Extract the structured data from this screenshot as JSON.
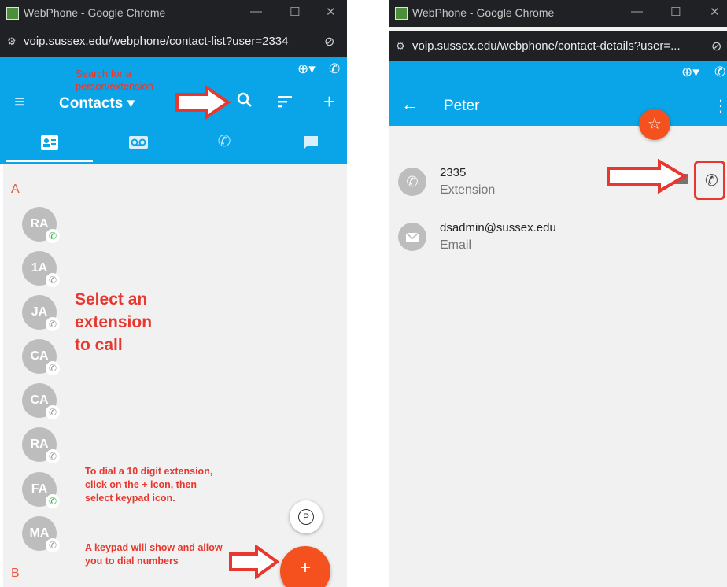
{
  "left": {
    "window_title": "WebPhone - Google Chrome",
    "url": "voip.sussex.edu/webphone/contact-list?user=2334",
    "header_title": "Contacts",
    "annotation_search": "Search for a person/extension",
    "annotation_select_1": "Select an",
    "annotation_select_2": "extension",
    "annotation_select_3": "to call",
    "annotation_dial": "To dial a 10 digit extension, click on the + icon, then select keypad icon.",
    "annotation_keypad": "A keypad will show and allow you to dial numbers",
    "section_a": "A",
    "section_b": "B",
    "contacts": [
      {
        "initials": "RA",
        "status": "green"
      },
      {
        "initials": "1A",
        "status": "grey"
      },
      {
        "initials": "JA",
        "status": "grey"
      },
      {
        "initials": "CA",
        "status": "grey"
      },
      {
        "initials": "CA",
        "status": "grey"
      },
      {
        "initials": "RA",
        "status": "grey"
      },
      {
        "initials": "FA",
        "status": "green"
      },
      {
        "initials": "MA",
        "status": "grey"
      }
    ],
    "p_fab_label": "P",
    "add_fab_label": "+"
  },
  "right": {
    "window_title": "WebPhone - Google Chrome",
    "url": "voip.sussex.edu/webphone/contact-details?user=...",
    "contact_name": "Peter",
    "extension_value": "2335",
    "extension_label": "Extension",
    "email_value": "dsadmin@sussex.edu",
    "email_label": "Email"
  },
  "colors": {
    "app_blue": "#0aa5e8",
    "accent_orange": "#f4511e",
    "annotation_red": "#e8372e",
    "presence_green": "#35b34a"
  }
}
